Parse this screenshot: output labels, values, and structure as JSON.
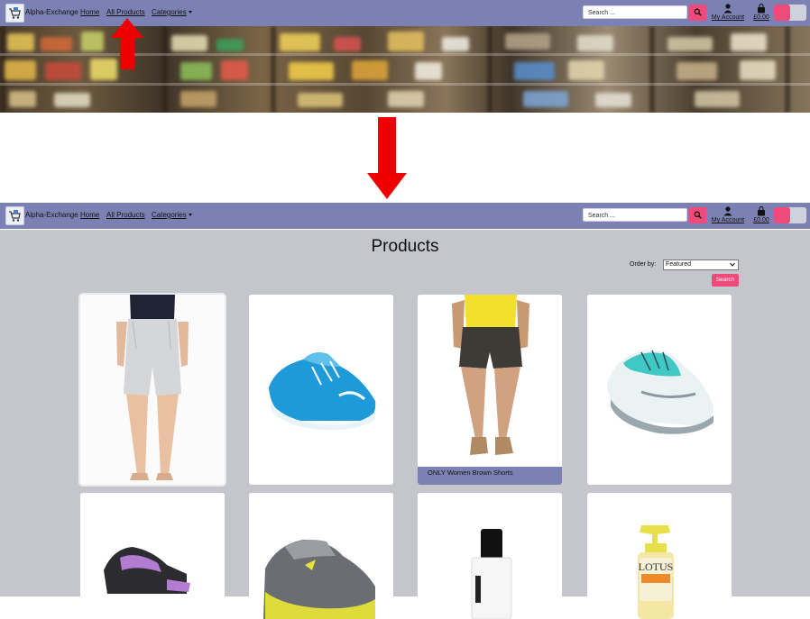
{
  "navbar": {
    "brand": "Alpha-Exchange",
    "links": {
      "home": "Home",
      "all_products": "All Products",
      "categories": "Categories"
    },
    "search_placeholder": "Search ...",
    "account_label": "My Account",
    "cart_total": "£0.00"
  },
  "products_page": {
    "title": "Products",
    "order_by_label": "Order by:",
    "order_by_value": "Featured",
    "sort_button": "Search",
    "cards": [
      {
        "image": "women-grey-shorts",
        "caption": ""
      },
      {
        "image": "blue-reebok-running-shoe",
        "caption": ""
      },
      {
        "image": "women-brown-shorts",
        "caption": "ONLY Women Brown Shorts"
      },
      {
        "image": "teal-nike-running-shoe",
        "caption": ""
      },
      {
        "image": "black-purple-sandal",
        "caption": ""
      },
      {
        "image": "grey-yellow-nike-shoe",
        "caption": ""
      },
      {
        "image": "white-cosmetic-bottle",
        "caption": ""
      },
      {
        "image": "lotus-herbals-lotion",
        "caption": ""
      }
    ]
  },
  "colors": {
    "navbar": "#7b82b3",
    "accent": "#ee4a7a",
    "page_background": "#c4c6cb",
    "annotation_arrow": "#ee0000"
  }
}
